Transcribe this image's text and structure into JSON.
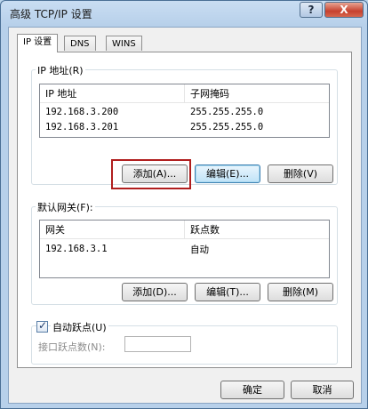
{
  "window": {
    "title": "高级 TCP/IP 设置",
    "help_label": "?",
    "close_label": "X"
  },
  "tabs": [
    {
      "label": "IP 设置"
    },
    {
      "label": "DNS"
    },
    {
      "label": "WINS"
    }
  ],
  "ip_group": {
    "label": "IP 地址(R)",
    "headers": [
      "IP 地址",
      "子网掩码"
    ],
    "rows": [
      [
        "192.168.3.200",
        "255.255.255.0"
      ],
      [
        "192.168.3.201",
        "255.255.255.0"
      ]
    ],
    "buttons": {
      "add": "添加(A)...",
      "edit": "编辑(E)...",
      "delete": "删除(V)"
    }
  },
  "gateway_group": {
    "label": "默认网关(F):",
    "headers": [
      "网关",
      "跃点数"
    ],
    "rows": [
      [
        "192.168.3.1",
        "自动"
      ]
    ],
    "buttons": {
      "add": "添加(D)...",
      "edit": "编辑(T)...",
      "delete": "删除(M)"
    }
  },
  "metric": {
    "auto_label": "自动跃点(U)",
    "auto_checked": true,
    "interface_label": "接口跃点数(N):",
    "interface_value": ""
  },
  "footer": {
    "ok": "确定",
    "cancel": "取消"
  }
}
